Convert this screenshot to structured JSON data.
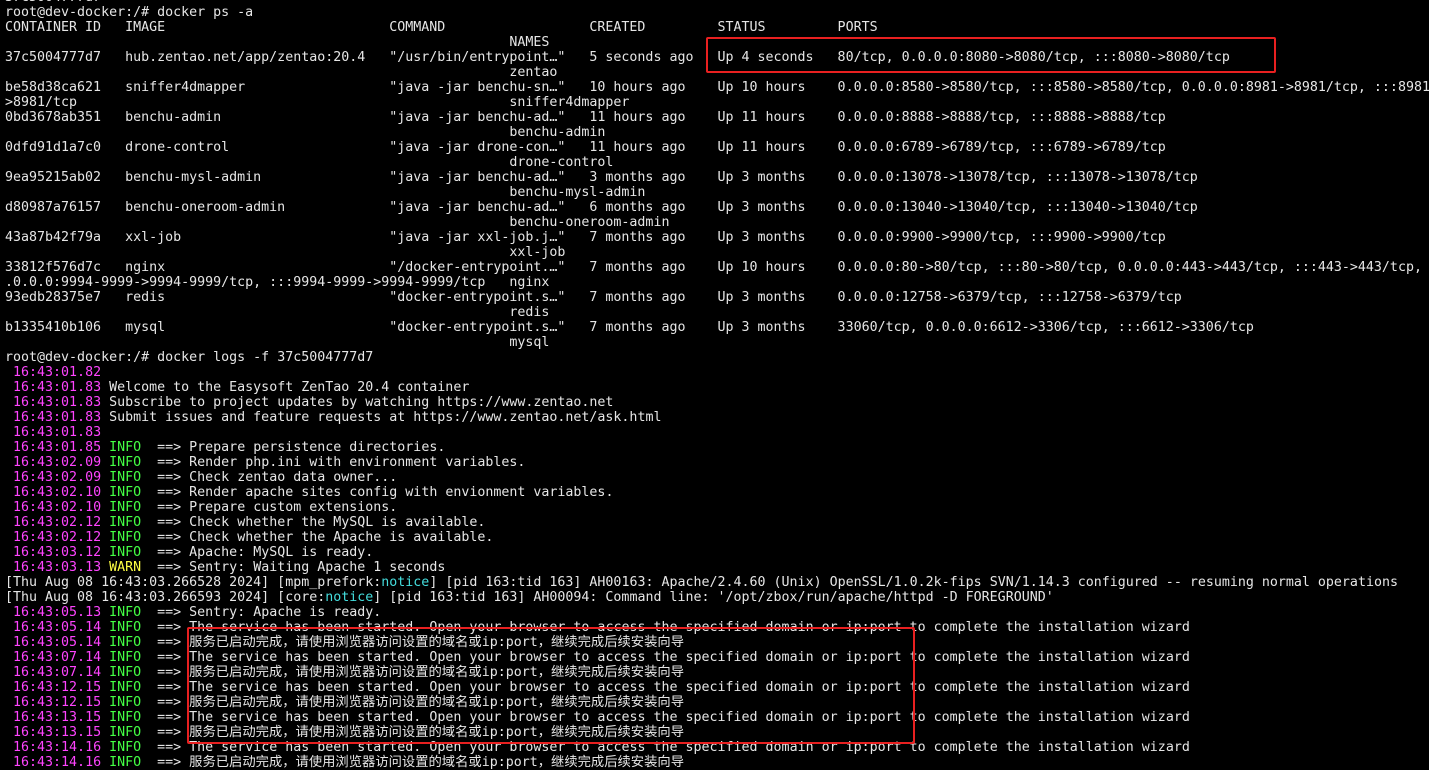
{
  "terminal": {
    "prompt": "root@dev-docker:/# ",
    "top_clipped_line": "37c5004777d7",
    "command_ps": "docker ps -a",
    "command_logs": "docker logs -f 37c5004777d7",
    "colors": {
      "timestamp": "#ff44ff",
      "info": "#44ff44",
      "warn": "#ffff44",
      "notice": "#44dddd",
      "highlight_box": "#e82020",
      "text": "#e6e6e6",
      "background": "#000000"
    }
  },
  "ps_table": {
    "headers": [
      "CONTAINER ID",
      "IMAGE",
      "COMMAND",
      "CREATED",
      "STATUS",
      "PORTS",
      "NAMES"
    ],
    "rows": [
      [
        "37c5004777d7",
        "hub.zentao.net/app/zentao:20.4",
        "\"/usr/bin/entrypoint…\"",
        "5 seconds ago",
        "Up 4 seconds",
        "80/tcp, 0.0.0.0:8080->8080/tcp, :::8080->8080/tcp",
        "zentao"
      ],
      [
        "be58d38ca621",
        "sniffer4dmapper",
        "\"java -jar benchu-sn…\"",
        "10 hours ago",
        "Up 10 hours",
        "0.0.0.0:8580->8580/tcp, :::8580->8580/tcp, 0.0.0.0:8981->8981/tcp, :::8981->8981/tcp",
        "sniffer4dmapper"
      ],
      [
        "0bd3678ab351",
        "benchu-admin",
        "\"java -jar benchu-ad…\"",
        "11 hours ago",
        "Up 11 hours",
        "0.0.0.0:8888->8888/tcp, :::8888->8888/tcp",
        "benchu-admin"
      ],
      [
        "0dfd91d1a7c0",
        "drone-control",
        "\"java -jar drone-con…\"",
        "11 hours ago",
        "Up 11 hours",
        "0.0.0.0:6789->6789/tcp, :::6789->6789/tcp",
        "drone-control"
      ],
      [
        "9ea95215ab02",
        "benchu-mysl-admin",
        "\"java -jar benchu-ad…\"",
        "3 months ago",
        "Up 3 months",
        "0.0.0.0:13078->13078/tcp, :::13078->13078/tcp",
        "benchu-mysl-admin"
      ],
      [
        "d80987a76157",
        "benchu-oneroom-admin",
        "\"java -jar benchu-ad…\"",
        "6 months ago",
        "Up 3 months",
        "0.0.0.0:13040->13040/tcp, :::13040->13040/tcp",
        "benchu-oneroom-admin"
      ],
      [
        "43a87b42f79a",
        "xxl-job",
        "\"java -jar xxl-job.j…\"",
        "7 months ago",
        "Up 3 months",
        "0.0.0.0:9900->9900/tcp, :::9900->9900/tcp",
        "xxl-job"
      ],
      [
        "33812f576d7c",
        "nginx",
        "\"/docker-entrypoint.…\"",
        "7 months ago",
        "Up 10 hours",
        "0.0.0.0:80->80/tcp, :::80->80/tcp, 0.0.0.0:443->443/tcp, :::443->443/tcp, 0.0.0.0:9994-9999->9994-9999/tcp, :::9994-9999->9994-9999/tcp",
        "nginx"
      ],
      [
        "93edb28375e7",
        "redis",
        "\"docker-entrypoint.s…\"",
        "7 months ago",
        "Up 3 months",
        "0.0.0.0:12758->6379/tcp, :::12758->6379/tcp",
        "redis"
      ],
      [
        "b1335410b106",
        "mysql",
        "\"docker-entrypoint.s…\"",
        "7 months ago",
        "Up 3 months",
        "33060/tcp, 0.0.0.0:6612->3306/tcp, :::6612->3306/tcp",
        "mysql"
      ]
    ]
  },
  "logs": [
    {
      "time": "16:43:01.82",
      "level": "",
      "msg": ""
    },
    {
      "time": "16:43:01.83",
      "level": "",
      "msg": "Welcome to the Easysoft ZenTao 20.4 container"
    },
    {
      "time": "16:43:01.83",
      "level": "",
      "msg": "Subscribe to project updates by watching https://www.zentao.net"
    },
    {
      "time": "16:43:01.83",
      "level": "",
      "msg": "Submit issues and feature requests at https://www.zentao.net/ask.html"
    },
    {
      "time": "16:43:01.83",
      "level": "",
      "msg": ""
    },
    {
      "time": "16:43:01.85",
      "level": "INFO",
      "msg": "Prepare persistence directories."
    },
    {
      "time": "16:43:02.09",
      "level": "INFO",
      "msg": "Render php.ini with environment variables."
    },
    {
      "time": "16:43:02.09",
      "level": "INFO",
      "msg": "Check zentao data owner..."
    },
    {
      "time": "16:43:02.10",
      "level": "INFO",
      "msg": "Render apache sites config with envionment variables."
    },
    {
      "time": "16:43:02.10",
      "level": "INFO",
      "msg": "Prepare custom extensions."
    },
    {
      "time": "16:43:02.12",
      "level": "INFO",
      "msg": "Check whether the MySQL is available."
    },
    {
      "time": "16:43:02.12",
      "level": "INFO",
      "msg": "Check whether the Apache is available."
    },
    {
      "time": "16:43:03.12",
      "level": "INFO",
      "msg": "Apache: MySQL is ready."
    },
    {
      "time": "16:43:03.13",
      "level": "WARN",
      "msg": "Sentry: Waiting Apache 1 seconds"
    },
    {
      "apache": [
        "[Thu Aug 08 16:43:03.266528 2024] [mpm_prefork:",
        "notice",
        "] [pid 163:tid 163] AH00163: Apache/2.4.60 (Unix) OpenSSL/1.0.2k-fips SVN/1.14.3 configured -- resuming normal operations"
      ]
    },
    {
      "apache": [
        "[Thu Aug 08 16:43:03.266593 2024] [core:",
        "notice",
        "] [pid 163:tid 163] AH00094: Command line: '/opt/zbox/run/apache/httpd -D FOREGROUND'"
      ]
    },
    {
      "time": "16:43:05.13",
      "level": "INFO",
      "msg": "Sentry: Apache is ready."
    },
    {
      "time": "16:43:05.14",
      "level": "INFO",
      "msg": "The service has been started. Open your browser to access the specified domain or ip:port to complete the installation wizard"
    },
    {
      "time": "16:43:05.14",
      "level": "INFO",
      "msg": "服务已启动完成，请使用浏览器访问设置的域名或ip:port，继续完成后续安装向导"
    },
    {
      "time": "16:43:07.14",
      "level": "INFO",
      "msg": "The service has been started. Open your browser to access the specified domain or ip:port to complete the installation wizard"
    },
    {
      "time": "16:43:07.14",
      "level": "INFO",
      "msg": "服务已启动完成，请使用浏览器访问设置的域名或ip:port，继续完成后续安装向导"
    },
    {
      "time": "16:43:12.15",
      "level": "INFO",
      "msg": "The service has been started. Open your browser to access the specified domain or ip:port to complete the installation wizard"
    },
    {
      "time": "16:43:12.15",
      "level": "INFO",
      "msg": "服务已启动完成，请使用浏览器访问设置的域名或ip:port，继续完成后续安装向导"
    },
    {
      "time": "16:43:13.15",
      "level": "INFO",
      "msg": "The service has been started. Open your browser to access the specified domain or ip:port to complete the installation wizard"
    },
    {
      "time": "16:43:13.15",
      "level": "INFO",
      "msg": "服务已启动完成，请使用浏览器访问设置的域名或ip:port，继续完成后续安装向导"
    },
    {
      "time": "16:43:14.16",
      "level": "INFO",
      "msg": "The service has been started. Open your browser to access the specified domain or ip:port to complete the installation wizard"
    },
    {
      "time": "16:43:14.16",
      "level": "INFO",
      "msg": "服务已启动完成，请使用浏览器访问设置的域名或ip:port，继续完成后续安装向导"
    }
  ]
}
